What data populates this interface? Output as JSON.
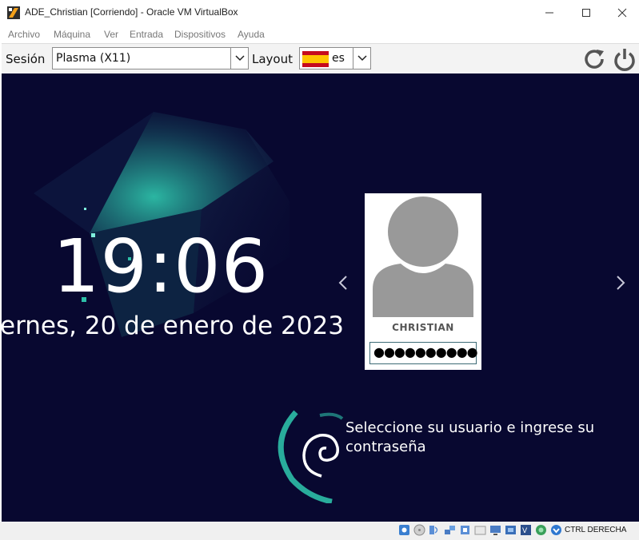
{
  "window": {
    "title": "ADE_Christian [Corriendo] - Oracle VM VirtualBox",
    "controls": [
      "minimize-icon",
      "maximize-icon",
      "close-icon"
    ]
  },
  "menu": {
    "items": [
      {
        "label": "Archivo"
      },
      {
        "label": "Máquina"
      },
      {
        "label": "Ver"
      },
      {
        "label": "Entrada"
      },
      {
        "label": "Dispositivos"
      },
      {
        "label": "Ayuda"
      }
    ]
  },
  "session_bar": {
    "session_label": "Sesión",
    "session_value": "Plasma (X11)",
    "layout_label": "Layout",
    "layout_value": "es",
    "icons": [
      "reboot-icon",
      "power-icon"
    ]
  },
  "lock_screen": {
    "time": "19:06",
    "date": "ernes, 20 de enero de 2023",
    "user": {
      "name": "CHRISTIAN",
      "password_masked": "●●●●●●●●●●"
    },
    "prompt": "Seleccione su usuario e ingrese su contraseña",
    "colors": {
      "background": "#080830",
      "accent": "#2dbfa8"
    }
  },
  "status_bar": {
    "icons": [
      "hard-disk-icon",
      "optical-drive-icon",
      "audio-icon",
      "network-icon",
      "usb-icon",
      "shared-folders-icon",
      "display-icon",
      "video-capture-icon",
      "virtualization-icon",
      "mouse-integration-icon",
      "keyboard-icon"
    ],
    "host_key": "CTRL DERECHA"
  }
}
